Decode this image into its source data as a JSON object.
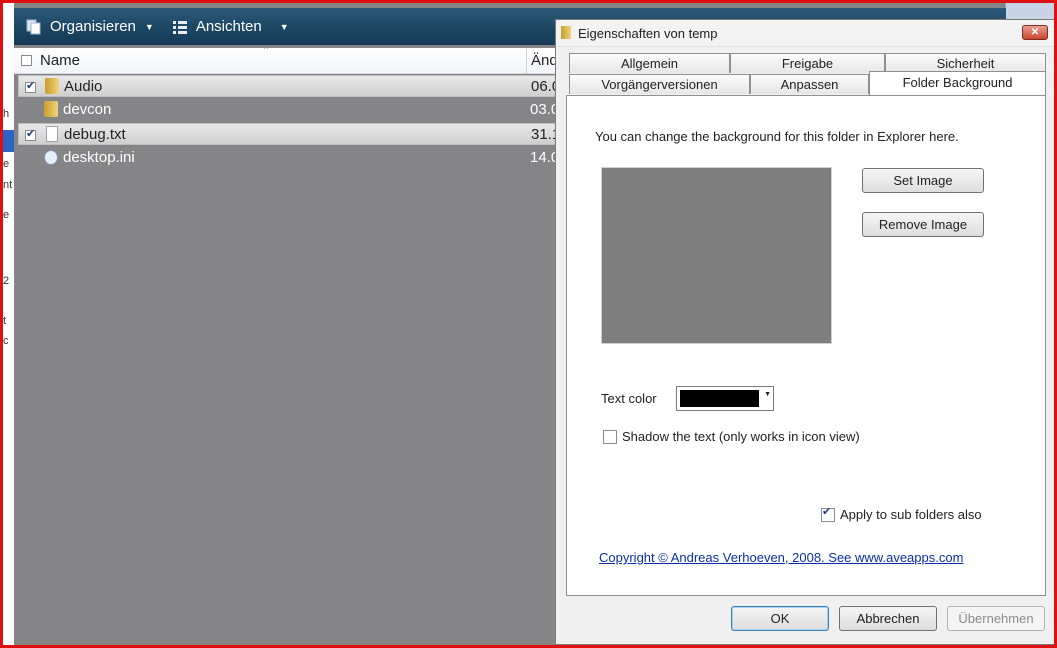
{
  "explorer": {
    "toolbar": {
      "organize_label": "Organisieren",
      "views_label": "Ansichten"
    },
    "columns": {
      "name": "Name",
      "date": "Änd"
    },
    "files": [
      {
        "name": "Audio",
        "date": "06.0",
        "type": "folder",
        "checked": true,
        "selected": true
      },
      {
        "name": "devcon",
        "date": "03.0",
        "type": "folder",
        "checked": false,
        "selected": false
      },
      {
        "name": "debug.txt",
        "date": "31.1",
        "type": "text",
        "checked": true,
        "selected": true
      },
      {
        "name": "desktop.ini",
        "date": "14.0",
        "type": "ini",
        "checked": false,
        "selected": false
      }
    ],
    "left_strip_chars": [
      "h",
      "e",
      "nt",
      "e",
      "2",
      "t",
      "c"
    ]
  },
  "dialog": {
    "title": "Eigenschaften von temp",
    "close_symbol": "✕",
    "tabs_row1": [
      "Allgemein",
      "Freigabe",
      "Sicherheit"
    ],
    "tabs_row2": [
      "Vorgängerversionen",
      "Anpassen",
      "Folder Background"
    ],
    "description": "You can change the background for this folder in Explorer here.",
    "set_image_label": "Set Image",
    "remove_image_label": "Remove Image",
    "text_color_label": "Text color",
    "text_color_value": "#000000",
    "shadow_label": "Shadow the text (only works in icon view)",
    "shadow_checked": false,
    "apply_sub_label": "Apply to sub folders also",
    "apply_sub_checked": true,
    "copyright_link": "Copyright © Andreas Verhoeven, 2008. See www.aveapps.com",
    "ok_label": "OK",
    "cancel_label": "Abbrechen",
    "apply_label": "Übernehmen"
  },
  "colors": {
    "explorer_bg": "#858487",
    "toolbar_bg": "#1c4662",
    "frame_red": "#e01010",
    "preview_gray": "#7e7e7e"
  }
}
